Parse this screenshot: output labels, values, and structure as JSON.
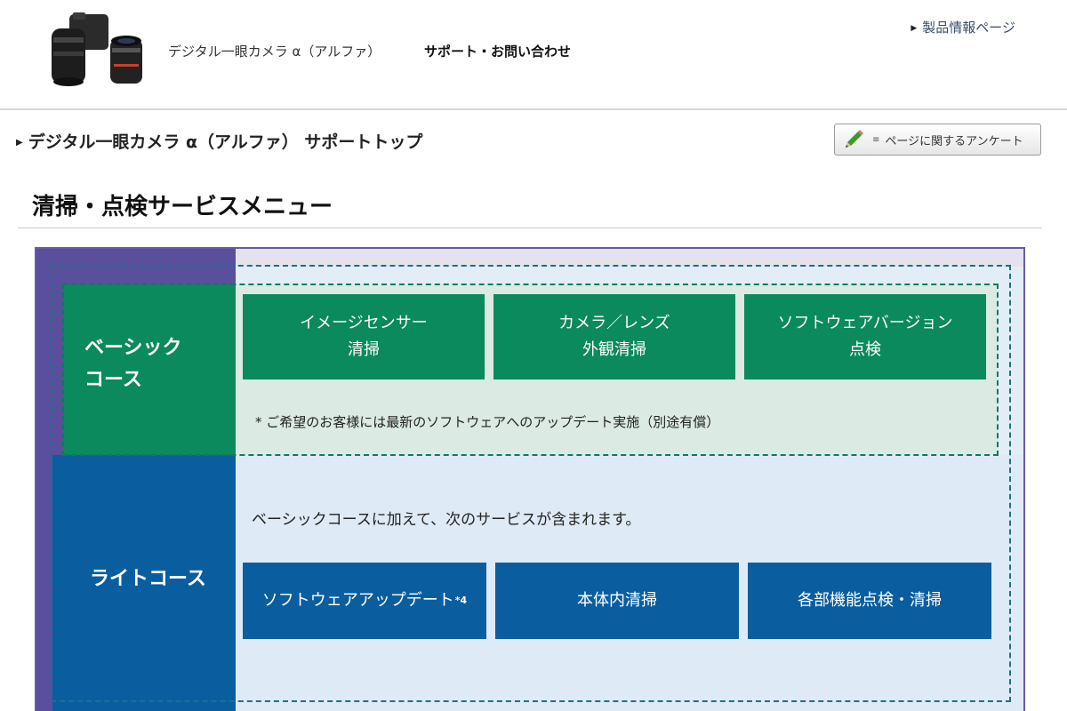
{
  "header": {
    "camera_image_alt": "camera-product-image",
    "nav_title": "デジタル一眼カメラ α（アルファ）",
    "nav_support": "サポート・お問い合わせ",
    "product_link": "製品情報ページ"
  },
  "breadcrumb": {
    "label": "デジタル一眼カメラ α（アルファ） サポートトップ"
  },
  "survey_button": {
    "label": "ページに関するアンケート",
    "icon": "pencil-icon"
  },
  "page_title": "清掃・点検サービスメニュー",
  "basic_course": {
    "label_line1": "ベーシック",
    "label_line2": "コース",
    "services": [
      {
        "line1": "イメージセンサー",
        "line2": "清掃"
      },
      {
        "line1": "カメラ／レンズ",
        "line2": "外観清掃"
      },
      {
        "line1": "ソフトウェアバージョン",
        "line2": "点検"
      }
    ],
    "note": "* ご希望のお客様には最新のソフトウェアへのアップデート実施（別途有償）"
  },
  "light_course": {
    "label": "ライトコース",
    "note": "ベーシックコースに加えて、次のサービスが含まれます。",
    "services": [
      {
        "label": "ソフトウェアアップデート",
        "sup": "*4"
      },
      {
        "label": "本体内清掃"
      },
      {
        "label": "各部機能点検・清掃"
      }
    ]
  },
  "colors": {
    "basic_green": "#0b8a5e",
    "light_blue": "#0a5ea0",
    "panel_purple": "#5a4f9c"
  }
}
